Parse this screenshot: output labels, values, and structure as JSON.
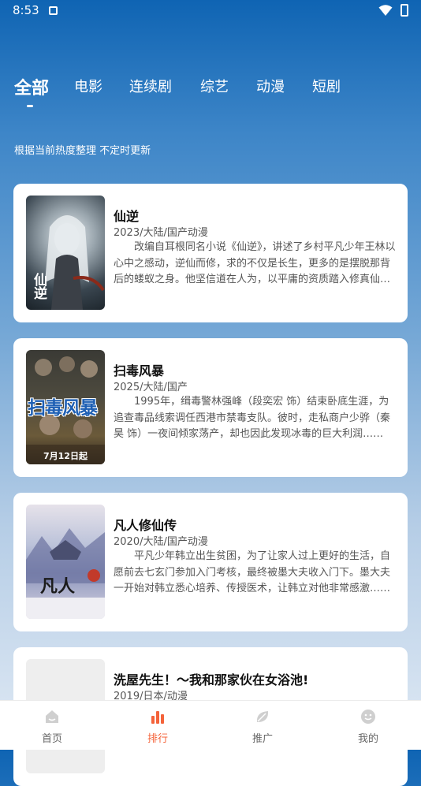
{
  "status_bar": {
    "time": "8:53"
  },
  "tabs": [
    "全部",
    "电影",
    "连续剧",
    "综艺",
    "动漫",
    "短剧"
  ],
  "subtitle": "根据当前热度整理 不定时更新",
  "items": [
    {
      "title": "仙逆",
      "meta": "2023/大陆/国产动漫",
      "desc": "改编自耳根同名小说《仙逆》，讲述了乡村平凡少年王林以心中之感动，逆仙而修，求的不仅是长生，更多的是摆脱那背后的蝼蚁之身。他坚信道在人为，以平庸的资质踏入修真仙途……",
      "poster_text": "仙逆"
    },
    {
      "title": "扫毒风暴",
      "meta": "2025/大陆/国产",
      "desc": "1995年，缉毒警林强峰（段奕宏 饰）结束卧底生涯，为追查毒品线索调任西港市禁毒支队。彼时，走私商户少骅（秦昊 饰）一夜间倾家荡产，却也因此发现冰毒的巨大利润……",
      "poster_text": "扫毒风暴",
      "poster_date": "7月12日起"
    },
    {
      "title": "凡人修仙传",
      "meta": "2020/大陆/国产动漫",
      "desc": "平凡少年韩立出生贫困，为了让家人过上更好的生活，自愿前去七玄门参加入门考核，最终被墨大夫收入门下。墨大夫一开始对韩立悉心培养、传授医术，让韩立对他非常感激……",
      "poster_text": "凡人"
    },
    {
      "title": "洗屋先生！～我和那家伙在女浴池!",
      "meta": "2019/日本/动漫",
      "desc": "",
      "poster_text": ""
    }
  ],
  "bottom_nav": [
    {
      "label": "首页",
      "icon": "home-icon"
    },
    {
      "label": "排行",
      "icon": "bar-chart-icon"
    },
    {
      "label": "推广",
      "icon": "leaf-icon"
    },
    {
      "label": "我的",
      "icon": "face-icon"
    }
  ],
  "colors": {
    "accent": "#f4633a",
    "header_blue": "#0f64b3"
  }
}
